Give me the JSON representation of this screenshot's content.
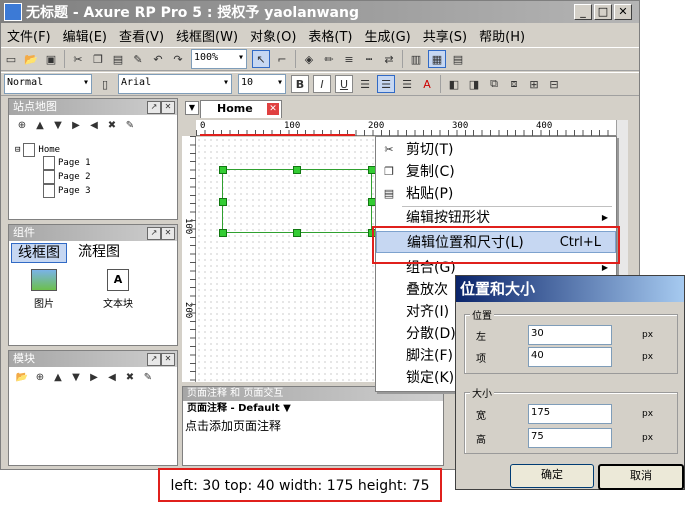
{
  "window": {
    "title": "无标题 - Axure RP Pro 5 : 授权予 yaolanwang",
    "controls": {
      "minimize": "_",
      "maximize": "□",
      "close": "✕"
    }
  },
  "menubar": [
    "文件(F)",
    "编辑(E)",
    "查看(V)",
    "线框图(W)",
    "对象(O)",
    "表格(T)",
    "生成(G)",
    "共享(S)",
    "帮助(H)"
  ],
  "toolbar": {
    "zoom": "100%",
    "style": "Normal",
    "font": "Arial",
    "font_size": "10",
    "bold": "B",
    "italic": "I",
    "underline": "U"
  },
  "sitemap": {
    "title": "站点地图",
    "root": "Home",
    "pages": [
      "Page 1",
      "Page 2",
      "Page 3"
    ]
  },
  "widgets": {
    "title": "组件",
    "tabs": [
      "线框图",
      "流程图"
    ],
    "items": [
      "图片",
      "文本块"
    ]
  },
  "masters": {
    "title": "模块"
  },
  "canvas": {
    "tab": "Home",
    "ruler_labels": [
      "0",
      "100",
      "200",
      "300",
      "400"
    ],
    "vruler_labels": [
      "100",
      "200"
    ],
    "shape_color": "#33cc33"
  },
  "notes": {
    "header": "页面注释 和 页面交互",
    "dropdown": "页面注释 - Default ▼",
    "placeholder": "点击添加页面注释"
  },
  "context_menu": {
    "items": [
      {
        "label": "剪切(T)",
        "icon": "scissors-icon"
      },
      {
        "label": "复制(C)",
        "icon": "copy-icon"
      },
      {
        "label": "粘贴(P)",
        "icon": "paste-icon"
      },
      {
        "label": "编辑按钮形状",
        "submenu": true
      },
      {
        "label": "编辑位置和尺寸(L)",
        "shortcut": "Ctrl+L",
        "highlighted": true
      },
      {
        "label": "组合(G)",
        "submenu": true
      },
      {
        "label": "叠放次"
      },
      {
        "label": "对齐(I)"
      },
      {
        "label": "分散(D)"
      },
      {
        "label": "脚注(F)"
      },
      {
        "label": "锁定(K)"
      }
    ]
  },
  "dialog": {
    "title": "位置和大小",
    "position_group": "位置",
    "left_label": "左",
    "left_value": "30",
    "top_label": "项",
    "top_value": "40",
    "size_group": "大小",
    "width_label": "宽",
    "width_value": "175",
    "height_label": "高",
    "height_value": "75",
    "unit": "px",
    "ok": "确定",
    "cancel": "取消"
  },
  "status": "left: 30   top: 40   width: 175   height: 75",
  "accent_colors": {
    "highlight_box": "#e0201c",
    "selection": "#c6d7f2"
  }
}
